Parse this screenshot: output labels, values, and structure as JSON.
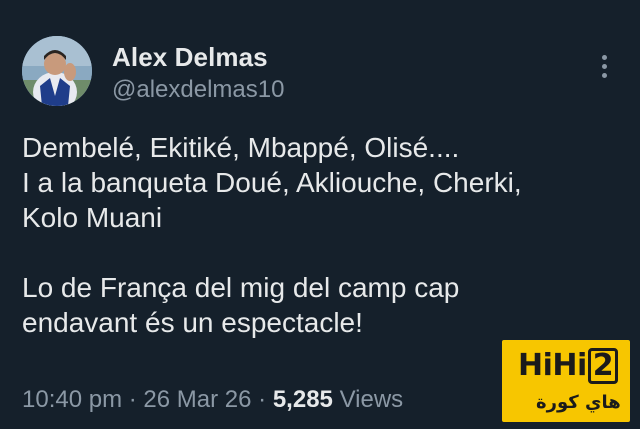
{
  "author": {
    "display_name": "Alex Delmas",
    "handle": "@alexdelmas10",
    "avatar": "profile-photo"
  },
  "menu": {
    "icon": "more-vertical-icon"
  },
  "tweet": {
    "lines": [
      "Dembelé, Ekitiké, Mbappé, Olisé....",
      "I a la banqueta Doué, Akliouche, Cherki,",
      "Kolo Muani",
      "Lo de França del mig del camp cap",
      "endavant és un espectacle!"
    ]
  },
  "meta": {
    "time": "10:40 pm",
    "separator": "·",
    "date": "26 Mar 26",
    "views_count": "5,285",
    "views_label": "Views"
  },
  "watermark": {
    "brand_latin": "HiHi2",
    "brand_arabic": "هاي كورة",
    "background": "#f7c600"
  },
  "colors": {
    "background": "#15202b",
    "text_primary": "#e7e9ea",
    "text_secondary": "#8b98a5"
  }
}
